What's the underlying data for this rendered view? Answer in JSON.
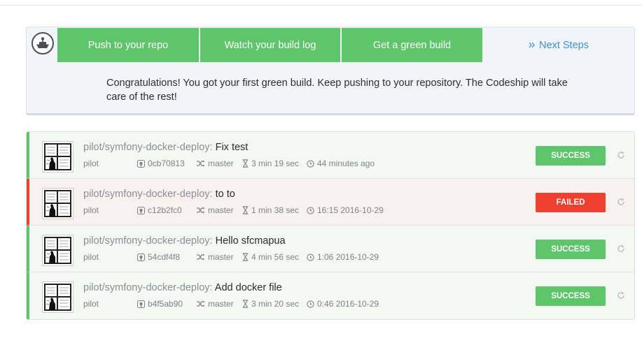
{
  "steps": {
    "step1": "Push to your repo",
    "step2": "Watch your build log",
    "step3": "Get a green build",
    "next": "Next Steps",
    "next_icon": "double-chevron-right-icon",
    "message": "Congratulations! You got your first green build. Keep pushing to your repository. The Codeship will take care of the rest!"
  },
  "colors": {
    "success": "#5ec56b",
    "failed": "#ef4030",
    "link": "#3f8fd8"
  },
  "builds": [
    {
      "repo": "pilot/symfony-docker-deploy:",
      "message": "Fix test",
      "author": "pilot",
      "commit": "0cb70813",
      "branch": "master",
      "duration": "3 min 19 sec",
      "time": "44 minutes ago",
      "status": "SUCCESS"
    },
    {
      "repo": "pilot/symfony-docker-deploy:",
      "message": "to to",
      "author": "pilot",
      "commit": "c12b2fc0",
      "branch": "master",
      "duration": "1 min 38 sec",
      "time": "16:15 2016-10-29",
      "status": "FAILED"
    },
    {
      "repo": "pilot/symfony-docker-deploy:",
      "message": "Hello sfcmapua",
      "author": "pilot",
      "commit": "54cdf4f8",
      "branch": "master",
      "duration": "4 min 56 sec",
      "time": "1:06 2016-10-29",
      "status": "SUCCESS"
    },
    {
      "repo": "pilot/symfony-docker-deploy:",
      "message": "Add docker file",
      "author": "pilot",
      "commit": "b4f5ab90",
      "branch": "master",
      "duration": "3 min 20 sec",
      "time": "0:46 2016-10-29",
      "status": "SUCCESS"
    }
  ]
}
